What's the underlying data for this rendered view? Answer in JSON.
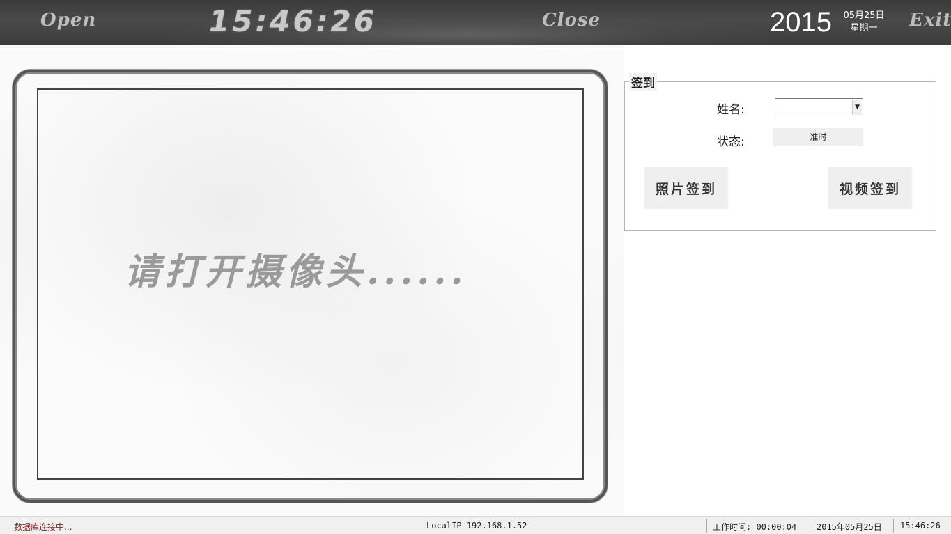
{
  "topbar": {
    "open_label": "Open",
    "clock": "15:46:26",
    "close_label": "Close",
    "year": "2015",
    "date": "05月25日",
    "weekday": "星期一",
    "exit_label": "Exit"
  },
  "camera": {
    "prompt": "请打开摄像头......"
  },
  "signin": {
    "title": "签到",
    "name_label": "姓名:",
    "name_value": "",
    "status_label": "状态:",
    "status_value": "准时",
    "photo_button": "照片签到",
    "video_button": "视频签到"
  },
  "statusbar": {
    "db_status": "数据库连接中...",
    "local_ip": "LocalIP 192.168.1.52",
    "work_time": "工作时间: 00:00:04",
    "date": "2015年05月25日",
    "time": "15:46:26"
  }
}
